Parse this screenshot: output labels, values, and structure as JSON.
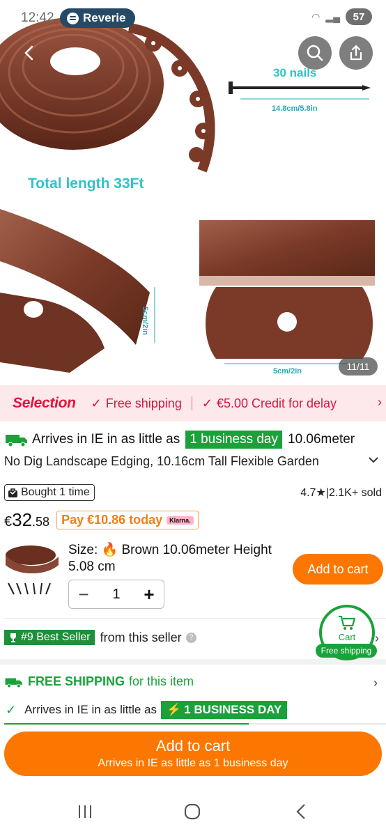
{
  "status_bar": {
    "time": "12:42",
    "app_pill": "Reverie",
    "battery": "57"
  },
  "gallery": {
    "counter": "11/11",
    "image_texts": {
      "nails": "30 nails",
      "nail_length": "14.8cm/5.8in",
      "total_length": "Total length 33Ft",
      "height_dim": "5cm/2in",
      "width_dim": "5cm/2in"
    },
    "colors": {
      "edging": "#7a3a28",
      "label": "#2ec4c9"
    }
  },
  "selection_bar": {
    "title": "Selection",
    "item1": "Free shipping",
    "item2": "€5.00 Credit for delay"
  },
  "title": {
    "arrive_prefix": "Arrives in IE in as little as",
    "arrive_badge": "1 business day",
    "arrive_suffix": "10.06meter",
    "line2": "No Dig Landscape Edging, 10.16cm Tall Flexible Garden"
  },
  "stats": {
    "bought": "Bought 1 time",
    "rating": "4.7",
    "sold": "2.1K+ sold"
  },
  "price": {
    "currency": "€",
    "main": "32",
    "decimal": ".58",
    "pay_today": "Pay €10.86 today",
    "klarna": "Klarna."
  },
  "variant": {
    "size_label": "Size:",
    "size_value": "Brown 10.06meter Height 5.08 cm",
    "quantity": "1",
    "add_to_cart": "Add to cart"
  },
  "seller": {
    "badge": "#9 Best Seller",
    "text": "from this seller"
  },
  "floating_cart": {
    "label": "Cart",
    "free_shipping": "Free shipping"
  },
  "shipping": {
    "free_strong": "FREE SHIPPING",
    "free_rest": "for this item",
    "arrives_text": "Arrives in IE in as little as",
    "arrives_badge": "1 BUSINESS DAY",
    "progress": 0.64
  },
  "bottom_cart": {
    "label": "Add to cart",
    "sublabel": "Arrives in IE as little as 1 business day"
  },
  "accent_colors": {
    "orange": "#fb7701",
    "green": "#19a23a",
    "red": "#e0143c"
  }
}
